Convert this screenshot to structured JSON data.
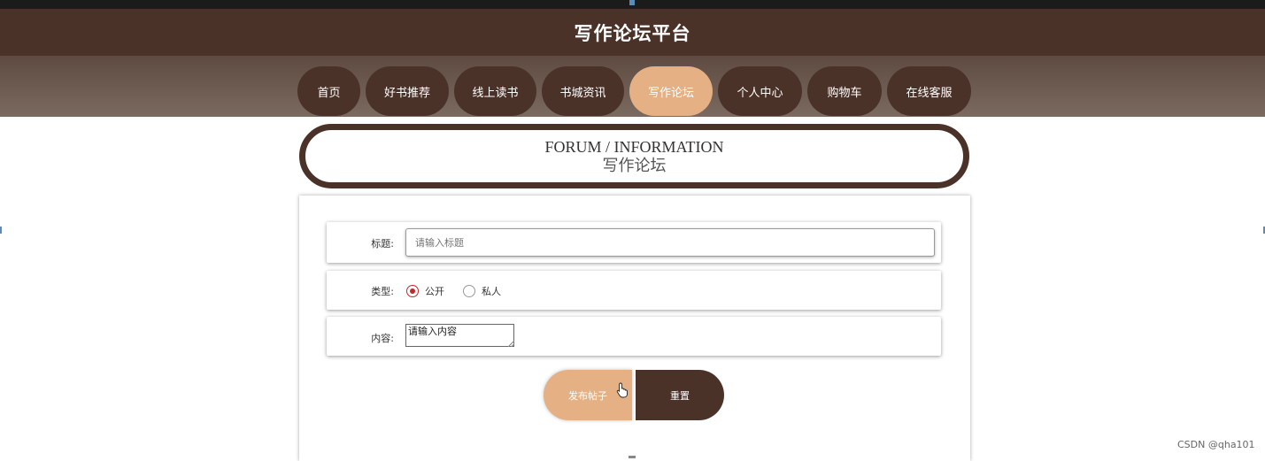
{
  "site": {
    "title": "写作论坛平台"
  },
  "nav": {
    "items": [
      {
        "label": "首页",
        "active": false
      },
      {
        "label": "好书推荐",
        "active": false
      },
      {
        "label": "线上读书",
        "active": false
      },
      {
        "label": "书城资讯",
        "active": false
      },
      {
        "label": "写作论坛",
        "active": true
      },
      {
        "label": "个人中心",
        "active": false
      },
      {
        "label": "购物车",
        "active": false
      },
      {
        "label": "在线客服",
        "active": false
      }
    ]
  },
  "banner": {
    "en": "FORUM / INFORMATION",
    "cn": "写作论坛"
  },
  "form": {
    "title_label": "标题:",
    "title_placeholder": "请输入标题",
    "type_label": "类型:",
    "type_options": [
      {
        "label": "公开",
        "checked": true
      },
      {
        "label": "私人",
        "checked": false
      }
    ],
    "content_label": "内容:",
    "content_value": "请输入内容",
    "submit_label": "发布帖子",
    "reset_label": "重置"
  },
  "watermark": "CSDN @qha101",
  "colors": {
    "brand": "#4b3229",
    "accent": "#e5b083",
    "radio": "#c0282c"
  }
}
